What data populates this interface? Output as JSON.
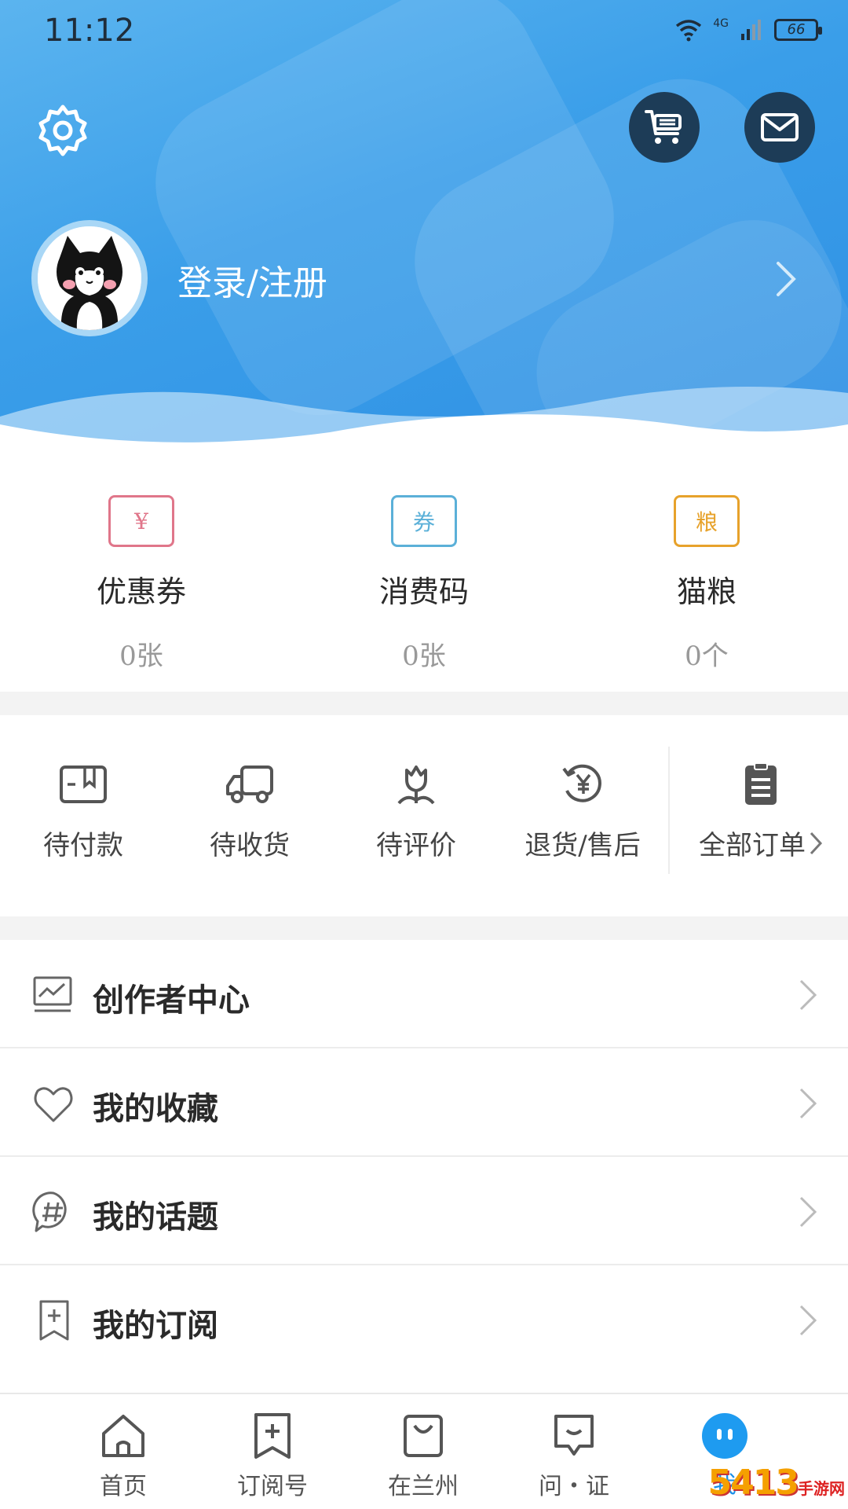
{
  "status_bar": {
    "time": "11:12",
    "network": "4G",
    "battery": "66"
  },
  "header": {
    "login_label": "登录/注册"
  },
  "wallet": [
    {
      "icon_text": "¥",
      "label": "优惠券",
      "value": "0张",
      "color": "#e0768a"
    },
    {
      "icon_text": "券",
      "label": "消费码",
      "value": "0张",
      "color": "#5bb0d8"
    },
    {
      "icon_text": "粮",
      "label": "猫粮",
      "value": "0个",
      "color": "#e7a22b"
    }
  ],
  "orders": [
    {
      "label": "待付款"
    },
    {
      "label": "待收货"
    },
    {
      "label": "待评价"
    },
    {
      "label": "退货/售后"
    }
  ],
  "orders_all_label": "全部订单",
  "menu": [
    {
      "label": "创作者中心"
    },
    {
      "label": "我的收藏"
    },
    {
      "label": "我的话题"
    },
    {
      "label": "我的订阅"
    }
  ],
  "tabs": [
    {
      "label": "首页"
    },
    {
      "label": "订阅号"
    },
    {
      "label": "在兰州"
    },
    {
      "label": "问・证"
    },
    {
      "label": "我"
    }
  ],
  "watermark": {
    "main": "5413",
    "sub": "手游网"
  },
  "colors": {
    "header_blue": "#3a9ee9",
    "active_tab": "#1a8fe8",
    "dark_button": "#1d3c57"
  }
}
